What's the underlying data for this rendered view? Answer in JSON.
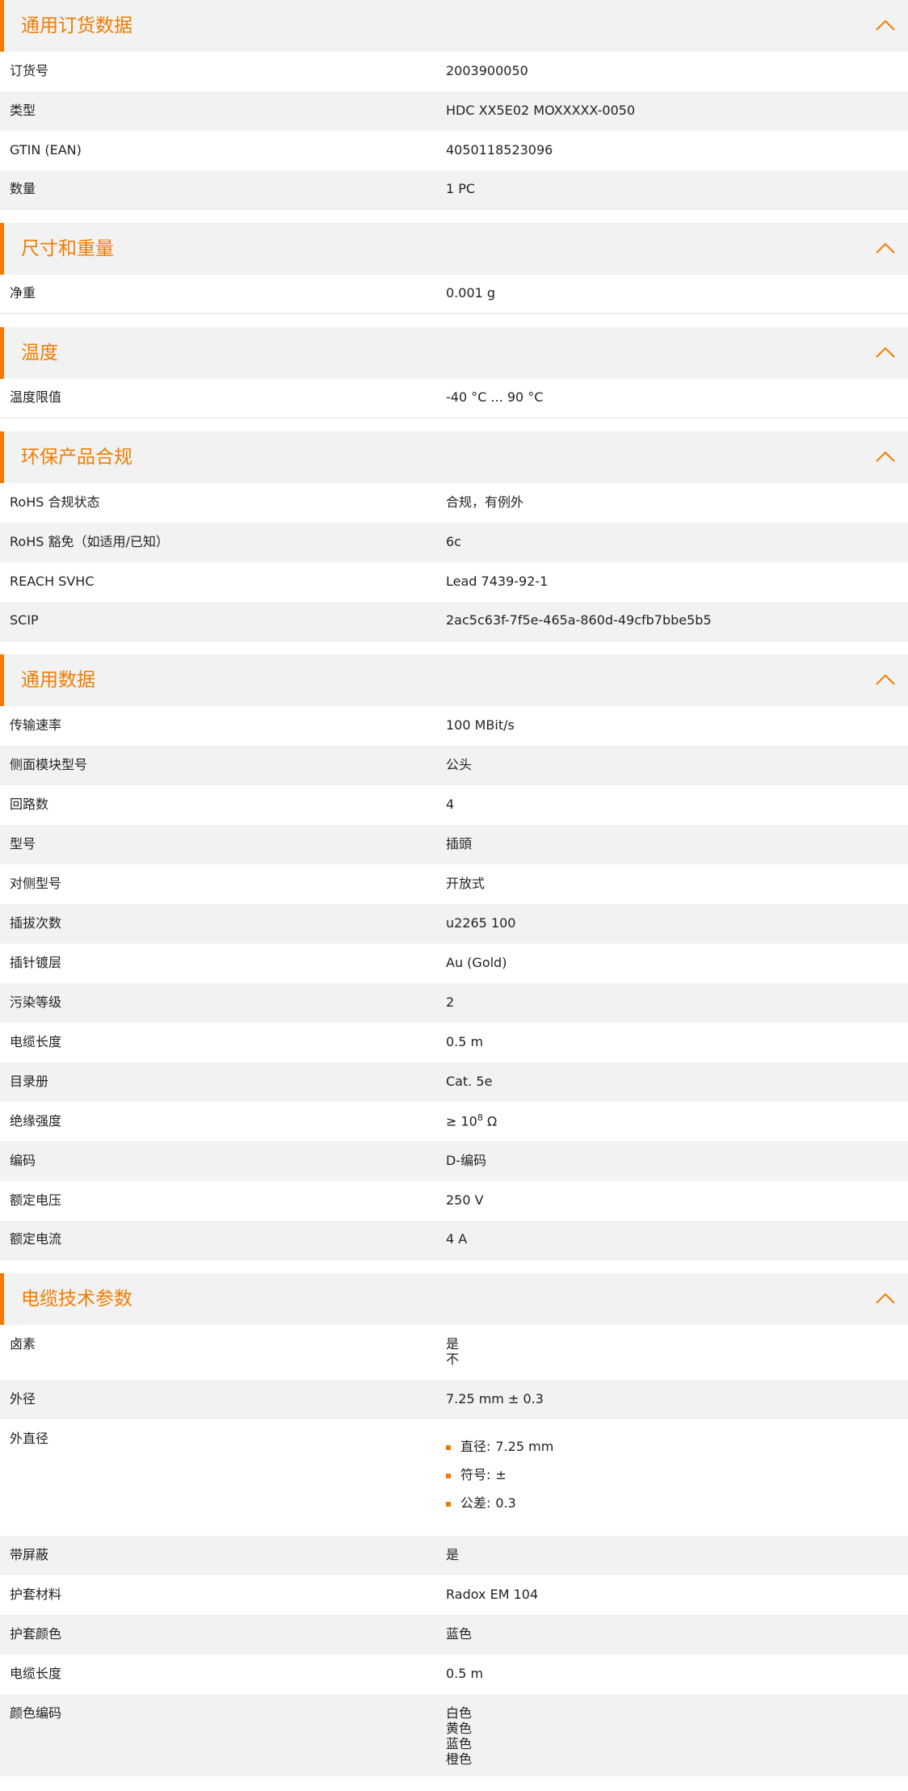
{
  "colors": {
    "accent": "#f07d00",
    "stripe": "#f2f2f2"
  },
  "sections": {
    "general_order": {
      "title": "通用订货数据",
      "rows": [
        {
          "label": "订货号",
          "value": "2003900050"
        },
        {
          "label": "类型",
          "value": "HDC XX5E02 MOXXXXX-0050"
        },
        {
          "label": "GTIN (EAN)",
          "value": "4050118523096"
        },
        {
          "label": "数量",
          "value": "1  PC"
        }
      ]
    },
    "dimensions": {
      "title": "尺寸和重量",
      "rows": [
        {
          "label": "净重",
          "value": "0.001  g"
        }
      ]
    },
    "temperature": {
      "title": "温度",
      "rows": [
        {
          "label": "温度限值",
          "value": "-40 °C ... 90 °C"
        }
      ]
    },
    "environment": {
      "title": "环保产品合规",
      "rows": [
        {
          "label": "RoHS 合规状态",
          "value": "合规，有例外"
        },
        {
          "label": "RoHS 豁免（如适用/已知）",
          "value": "6c"
        },
        {
          "label": "REACH SVHC",
          "value": "Lead 7439-92-1"
        },
        {
          "label": "SCIP",
          "value": "2ac5c63f-7f5e-465a-860d-49cfb7bbe5b5"
        }
      ]
    },
    "general_data": {
      "title": "通用数据",
      "rows": [
        {
          "label": "传输速率",
          "value": "100 MBit/s"
        },
        {
          "label": "侧面模块型号",
          "value": "公头"
        },
        {
          "label": "回路数",
          "value": "4"
        },
        {
          "label": "型号",
          "value": "插頭"
        },
        {
          "label": "对侧型号",
          "value": "开放式"
        },
        {
          "label": "插拔次数",
          "value": "u2265 100"
        },
        {
          "label": "插针镀层",
          "value": "Au (Gold)"
        },
        {
          "label": "污染等级",
          "value": "2"
        },
        {
          "label": "电缆长度",
          "value": "0.5  m"
        },
        {
          "label": "目录册",
          "value": "Cat. 5e"
        },
        {
          "label": "绝缘强度",
          "value_prefix": "≥ 10",
          "value_sup": "8",
          "value_suffix": " Ω"
        },
        {
          "label": "编码",
          "value": "D-编码"
        },
        {
          "label": "额定电压",
          "value": "250  V"
        },
        {
          "label": "额定电流",
          "value": "4  A"
        }
      ]
    },
    "cable": {
      "title": "电缆技术参数",
      "halogen": {
        "label": "卤素",
        "values": [
          "是",
          "不"
        ]
      },
      "outer_diameter": {
        "label": "外径",
        "value": "7.25 mm ± 0.3"
      },
      "outer_dia_detail": {
        "label": "外直径",
        "items": [
          {
            "key": "直径:",
            "val": "7.25 mm"
          },
          {
            "key": "符号:",
            "val": "±"
          },
          {
            "key": "公差:",
            "val": "0.3"
          }
        ]
      },
      "shielded": {
        "label": "带屏蔽",
        "value": "是"
      },
      "jacket_material": {
        "label": "护套材料",
        "value": "Radox EM 104"
      },
      "jacket_color": {
        "label": "护套颜色",
        "value": "蓝色"
      },
      "cable_length": {
        "label": "电缆长度",
        "value": "0.5  m"
      },
      "color_code": {
        "label": "颜色编码",
        "values": [
          "白色",
          "黄色",
          "蓝色",
          "橙色"
        ]
      }
    }
  }
}
